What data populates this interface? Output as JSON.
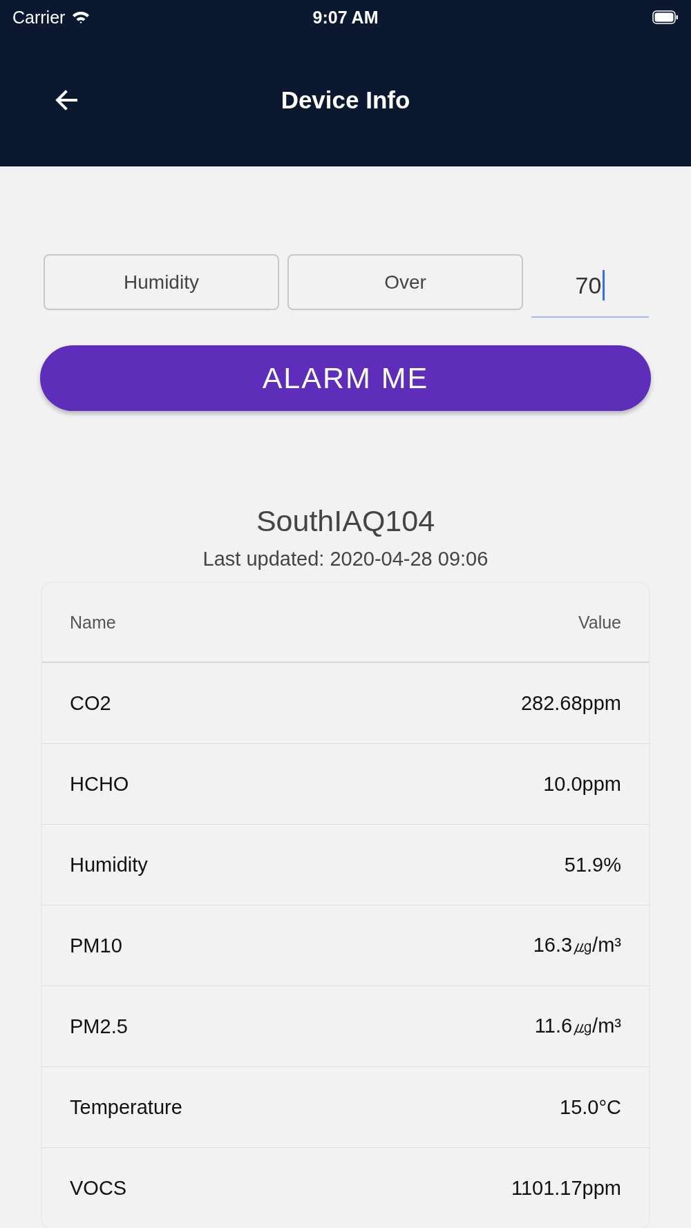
{
  "status_bar": {
    "carrier": "Carrier",
    "time": "9:07 AM"
  },
  "header": {
    "title": "Device Info"
  },
  "alarm_form": {
    "parameter": "Humidity",
    "condition": "Over",
    "threshold": "70",
    "button": "ALARM ME"
  },
  "device": {
    "name": "SouthIAQ104",
    "last_updated": "Last updated: 2020-04-28 09:06"
  },
  "table": {
    "columns": [
      "Name",
      "Value"
    ],
    "rows": [
      {
        "name": "CO2",
        "value": "282.68ppm"
      },
      {
        "name": "HCHO",
        "value": "10.0ppm"
      },
      {
        "name": "Humidity",
        "value": "51.9%"
      },
      {
        "name": "PM10",
        "value": "16.3㎍/m³"
      },
      {
        "name": "PM2.5",
        "value": "11.6㎍/m³"
      },
      {
        "name": "Temperature",
        "value": "15.0°C"
      },
      {
        "name": "VOCS",
        "value": "1101.17ppm"
      }
    ]
  }
}
